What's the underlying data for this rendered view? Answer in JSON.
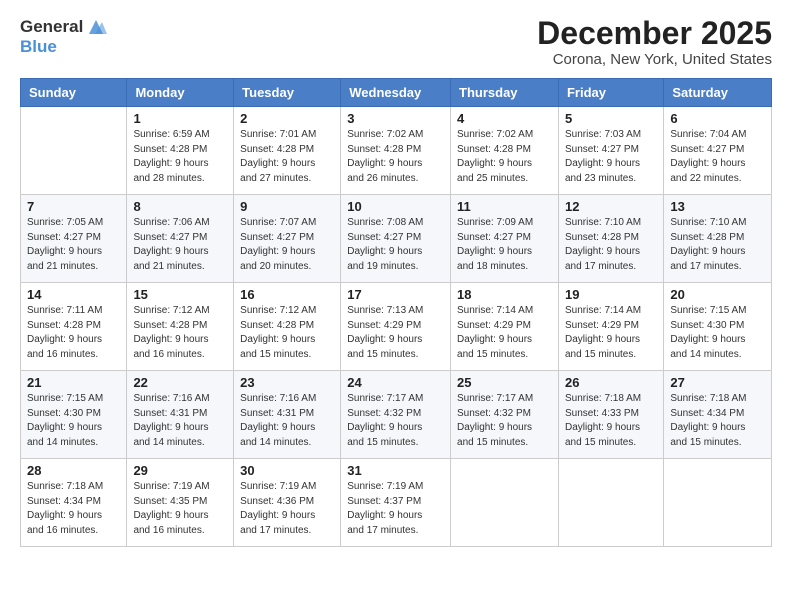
{
  "logo": {
    "general": "General",
    "blue": "Blue"
  },
  "title": "December 2025",
  "location": "Corona, New York, United States",
  "days_of_week": [
    "Sunday",
    "Monday",
    "Tuesday",
    "Wednesday",
    "Thursday",
    "Friday",
    "Saturday"
  ],
  "weeks": [
    [
      {
        "day": "",
        "sunrise": "",
        "sunset": "",
        "daylight": ""
      },
      {
        "day": "1",
        "sunrise": "Sunrise: 6:59 AM",
        "sunset": "Sunset: 4:28 PM",
        "daylight": "Daylight: 9 hours and 28 minutes."
      },
      {
        "day": "2",
        "sunrise": "Sunrise: 7:01 AM",
        "sunset": "Sunset: 4:28 PM",
        "daylight": "Daylight: 9 hours and 27 minutes."
      },
      {
        "day": "3",
        "sunrise": "Sunrise: 7:02 AM",
        "sunset": "Sunset: 4:28 PM",
        "daylight": "Daylight: 9 hours and 26 minutes."
      },
      {
        "day": "4",
        "sunrise": "Sunrise: 7:02 AM",
        "sunset": "Sunset: 4:28 PM",
        "daylight": "Daylight: 9 hours and 25 minutes."
      },
      {
        "day": "5",
        "sunrise": "Sunrise: 7:03 AM",
        "sunset": "Sunset: 4:27 PM",
        "daylight": "Daylight: 9 hours and 23 minutes."
      },
      {
        "day": "6",
        "sunrise": "Sunrise: 7:04 AM",
        "sunset": "Sunset: 4:27 PM",
        "daylight": "Daylight: 9 hours and 22 minutes."
      }
    ],
    [
      {
        "day": "7",
        "sunrise": "Sunrise: 7:05 AM",
        "sunset": "Sunset: 4:27 PM",
        "daylight": "Daylight: 9 hours and 21 minutes."
      },
      {
        "day": "8",
        "sunrise": "Sunrise: 7:06 AM",
        "sunset": "Sunset: 4:27 PM",
        "daylight": "Daylight: 9 hours and 21 minutes."
      },
      {
        "day": "9",
        "sunrise": "Sunrise: 7:07 AM",
        "sunset": "Sunset: 4:27 PM",
        "daylight": "Daylight: 9 hours and 20 minutes."
      },
      {
        "day": "10",
        "sunrise": "Sunrise: 7:08 AM",
        "sunset": "Sunset: 4:27 PM",
        "daylight": "Daylight: 9 hours and 19 minutes."
      },
      {
        "day": "11",
        "sunrise": "Sunrise: 7:09 AM",
        "sunset": "Sunset: 4:27 PM",
        "daylight": "Daylight: 9 hours and 18 minutes."
      },
      {
        "day": "12",
        "sunrise": "Sunrise: 7:10 AM",
        "sunset": "Sunset: 4:28 PM",
        "daylight": "Daylight: 9 hours and 17 minutes."
      },
      {
        "day": "13",
        "sunrise": "Sunrise: 7:10 AM",
        "sunset": "Sunset: 4:28 PM",
        "daylight": "Daylight: 9 hours and 17 minutes."
      }
    ],
    [
      {
        "day": "14",
        "sunrise": "Sunrise: 7:11 AM",
        "sunset": "Sunset: 4:28 PM",
        "daylight": "Daylight: 9 hours and 16 minutes."
      },
      {
        "day": "15",
        "sunrise": "Sunrise: 7:12 AM",
        "sunset": "Sunset: 4:28 PM",
        "daylight": "Daylight: 9 hours and 16 minutes."
      },
      {
        "day": "16",
        "sunrise": "Sunrise: 7:12 AM",
        "sunset": "Sunset: 4:28 PM",
        "daylight": "Daylight: 9 hours and 15 minutes."
      },
      {
        "day": "17",
        "sunrise": "Sunrise: 7:13 AM",
        "sunset": "Sunset: 4:29 PM",
        "daylight": "Daylight: 9 hours and 15 minutes."
      },
      {
        "day": "18",
        "sunrise": "Sunrise: 7:14 AM",
        "sunset": "Sunset: 4:29 PM",
        "daylight": "Daylight: 9 hours and 15 minutes."
      },
      {
        "day": "19",
        "sunrise": "Sunrise: 7:14 AM",
        "sunset": "Sunset: 4:29 PM",
        "daylight": "Daylight: 9 hours and 15 minutes."
      },
      {
        "day": "20",
        "sunrise": "Sunrise: 7:15 AM",
        "sunset": "Sunset: 4:30 PM",
        "daylight": "Daylight: 9 hours and 14 minutes."
      }
    ],
    [
      {
        "day": "21",
        "sunrise": "Sunrise: 7:15 AM",
        "sunset": "Sunset: 4:30 PM",
        "daylight": "Daylight: 9 hours and 14 minutes."
      },
      {
        "day": "22",
        "sunrise": "Sunrise: 7:16 AM",
        "sunset": "Sunset: 4:31 PM",
        "daylight": "Daylight: 9 hours and 14 minutes."
      },
      {
        "day": "23",
        "sunrise": "Sunrise: 7:16 AM",
        "sunset": "Sunset: 4:31 PM",
        "daylight": "Daylight: 9 hours and 14 minutes."
      },
      {
        "day": "24",
        "sunrise": "Sunrise: 7:17 AM",
        "sunset": "Sunset: 4:32 PM",
        "daylight": "Daylight: 9 hours and 15 minutes."
      },
      {
        "day": "25",
        "sunrise": "Sunrise: 7:17 AM",
        "sunset": "Sunset: 4:32 PM",
        "daylight": "Daylight: 9 hours and 15 minutes."
      },
      {
        "day": "26",
        "sunrise": "Sunrise: 7:18 AM",
        "sunset": "Sunset: 4:33 PM",
        "daylight": "Daylight: 9 hours and 15 minutes."
      },
      {
        "day": "27",
        "sunrise": "Sunrise: 7:18 AM",
        "sunset": "Sunset: 4:34 PM",
        "daylight": "Daylight: 9 hours and 15 minutes."
      }
    ],
    [
      {
        "day": "28",
        "sunrise": "Sunrise: 7:18 AM",
        "sunset": "Sunset: 4:34 PM",
        "daylight": "Daylight: 9 hours and 16 minutes."
      },
      {
        "day": "29",
        "sunrise": "Sunrise: 7:19 AM",
        "sunset": "Sunset: 4:35 PM",
        "daylight": "Daylight: 9 hours and 16 minutes."
      },
      {
        "day": "30",
        "sunrise": "Sunrise: 7:19 AM",
        "sunset": "Sunset: 4:36 PM",
        "daylight": "Daylight: 9 hours and 17 minutes."
      },
      {
        "day": "31",
        "sunrise": "Sunrise: 7:19 AM",
        "sunset": "Sunset: 4:37 PM",
        "daylight": "Daylight: 9 hours and 17 minutes."
      },
      {
        "day": "",
        "sunrise": "",
        "sunset": "",
        "daylight": ""
      },
      {
        "day": "",
        "sunrise": "",
        "sunset": "",
        "daylight": ""
      },
      {
        "day": "",
        "sunrise": "",
        "sunset": "",
        "daylight": ""
      }
    ]
  ]
}
